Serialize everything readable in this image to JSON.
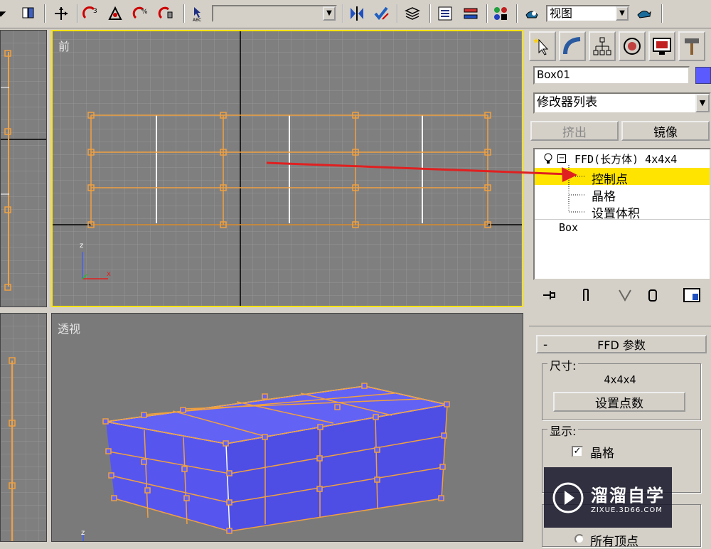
{
  "toolbar": {
    "view_combo": "视图",
    "selection_combo": ""
  },
  "viewports": {
    "front_label": "前",
    "persp_label": "透视",
    "axis_z": "z",
    "axis_x": "x"
  },
  "command_panel": {
    "object_name": "Box01",
    "object_color": "#5a5aff",
    "modifier_list": "修改器列表",
    "extrude_button": "挤出",
    "mirror_button": "镜像",
    "stack": {
      "modifier": "FFD(长方体) 4x4x4",
      "sub_items": [
        "控制点",
        "晶格",
        "设置体积"
      ],
      "base_object": "Box"
    },
    "rollout_title": "FFD 参数",
    "rollout_toggle": "-",
    "dimensions_group": "尺寸:",
    "dimensions_value": "4x4x4",
    "set_points_button": "设置点数",
    "display_group": "显示:",
    "lattice_checkbox": "晶格",
    "all_vertices_partial": "所有顶点"
  },
  "watermark": {
    "brand": "溜溜自学",
    "url": "ZIXUE.3D66.COM"
  },
  "colors": {
    "highlight": "#ffe400",
    "lattice": "#f0a040",
    "box": "#5858f0",
    "arrow": "#e02020"
  }
}
